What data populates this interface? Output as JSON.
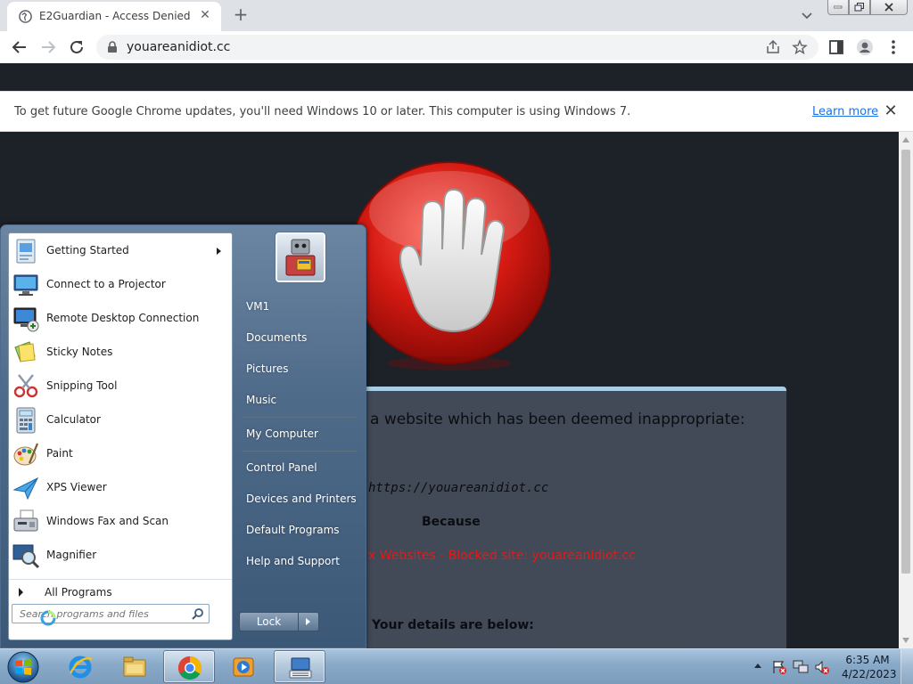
{
  "browser": {
    "tab_title": "E2Guardian - Access Denied",
    "url": "youareanidiot.cc",
    "infobar_message": "To get future Google Chrome updates, you'll need Windows 10 or later. This computer is using Windows 7.",
    "infobar_link": "Learn more"
  },
  "page": {
    "heading": "a website which has been deemed inappropriate:",
    "blocked_url": "https://youareanidiot.cc",
    "because": "Because",
    "reason": "x Websites - Blocked site: youareanidiot.cc",
    "details": "Your details are below:",
    "accent_color": "#e21a1a"
  },
  "start_menu": {
    "programs": [
      {
        "label": "Getting Started",
        "icon": "getting-started-icon",
        "submenu": true
      },
      {
        "label": "Connect to a Projector",
        "icon": "projector-icon"
      },
      {
        "label": "Remote Desktop Connection",
        "icon": "remote-desktop-icon"
      },
      {
        "label": "Sticky Notes",
        "icon": "sticky-notes-icon"
      },
      {
        "label": "Snipping Tool",
        "icon": "scissors-icon"
      },
      {
        "label": "Calculator",
        "icon": "calculator-icon"
      },
      {
        "label": "Paint",
        "icon": "paint-icon"
      },
      {
        "label": "XPS Viewer",
        "icon": "xps-viewer-icon"
      },
      {
        "label": "Windows Fax and Scan",
        "icon": "fax-icon"
      },
      {
        "label": "Magnifier",
        "icon": "magnifier-icon"
      }
    ],
    "all_programs": "All Programs",
    "search_placeholder": "Search programs and files",
    "right_links": {
      "user": "VM1",
      "documents": "Documents",
      "pictures": "Pictures",
      "music": "Music",
      "computer": "My Computer",
      "control_panel": "Control Panel",
      "devices": "Devices and Printers",
      "default_programs": "Default Programs",
      "help": "Help and Support"
    },
    "lock_label": "Lock"
  },
  "taskbar": {
    "time": "6:35 AM",
    "date": "4/22/2023",
    "pinned": [
      "internet-explorer-icon",
      "explorer-icon",
      "chrome-icon",
      "media-player-icon",
      "keyboard-icon"
    ]
  }
}
